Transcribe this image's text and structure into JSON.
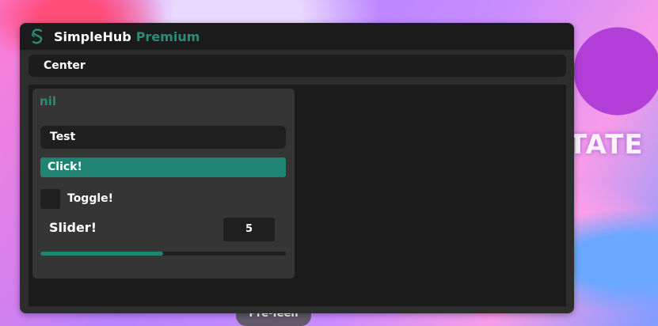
{
  "background": {
    "text": "TATE",
    "pill_text": "Pre-Teen"
  },
  "window": {
    "app_name": "SimpleHub",
    "edition": "Premium",
    "logo_icon": "simplehub-logo-icon",
    "accent_color": "#1f8471"
  },
  "tabs": [
    {
      "label": "Center"
    }
  ],
  "section": {
    "title": "nil",
    "textbox_value": "Test",
    "button_label": "Click!",
    "toggle": {
      "label": "Toggle!",
      "checked": false
    },
    "slider": {
      "label": "Slider!",
      "value": "5",
      "fill_fraction": 0.5
    }
  }
}
